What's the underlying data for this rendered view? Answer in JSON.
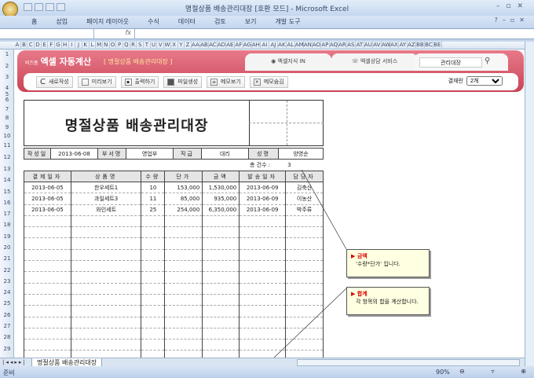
{
  "window": {
    "title": "명절상품 배송관리대장 [호환 모드] - Microsoft Excel"
  },
  "ribbon_tabs": [
    "홈",
    "삽입",
    "페이지 레이아웃",
    "수식",
    "데이터",
    "검토",
    "보기",
    "개발 도구"
  ],
  "formula": {
    "fx": "fx"
  },
  "columns": [
    "A",
    "B",
    "C",
    "D",
    "E",
    "F",
    "G",
    "H",
    "I",
    "J",
    "K",
    "L",
    "M",
    "N",
    "O",
    "P",
    "Q",
    "R",
    "S",
    "T",
    "U",
    "V",
    "W",
    "X",
    "Y",
    "Z",
    "AA",
    "AB",
    "AC",
    "AD",
    "AE",
    "AF",
    "AG",
    "AH",
    "AI",
    "AJ",
    "AK",
    "AL",
    "AM",
    "AN",
    "AO",
    "AP",
    "AQ",
    "AR",
    "AS",
    "AT",
    "AU",
    "AV",
    "AW",
    "AX",
    "AY",
    "AZ",
    "BB",
    "BC",
    "BE"
  ],
  "banner": {
    "brand_small": "비즈폼",
    "brand": "엑셀 자동계산",
    "subtitle": "[ 명절상품 배송관리대장 ]",
    "tab1": "엑셀지식 IN",
    "tab2": "엑셀상담 서비스",
    "search": "관리대장",
    "buttons": [
      "새로작성",
      "미리보기",
      "출력하기",
      "파일생성",
      "메모보기",
      "메모숨김"
    ],
    "approval_label": "결재란",
    "approval_value": "2개"
  },
  "doc": {
    "title": "명절상품 배송관리대장",
    "info": {
      "date_label": "작성일",
      "date": "2013-06-08",
      "dept_label": "부서명",
      "dept": "영업부",
      "rank_label": "직급",
      "rank": "대리",
      "name_label": "성명",
      "name": "양영순"
    },
    "count_label": "총 건수 :",
    "count": "3",
    "headers": [
      "결제일자",
      "상품명",
      "수량",
      "단가",
      "금액",
      "발송일자",
      "담당자"
    ],
    "rows": [
      [
        "2013-06-05",
        "한우세트1",
        "10",
        "153,000",
        "1,530,000",
        "2013-06-09",
        "김축산"
      ],
      [
        "2013-06-05",
        "과일세트3",
        "11",
        "85,000",
        "935,000",
        "2013-06-09",
        "이농산"
      ],
      [
        "2013-06-05",
        "와인세트",
        "25",
        "254,000",
        "6,350,000",
        "2013-06-09",
        "박주류"
      ]
    ]
  },
  "comments": [
    {
      "title": "금액",
      "body": "'수량*단가' 입니다."
    },
    {
      "title": "합계",
      "body": "각 항목의 합을 계산합니다."
    }
  ],
  "sheet_tab": "명절상품 배송관리대장",
  "status": {
    "ready": "준비",
    "zoom": "90%"
  }
}
